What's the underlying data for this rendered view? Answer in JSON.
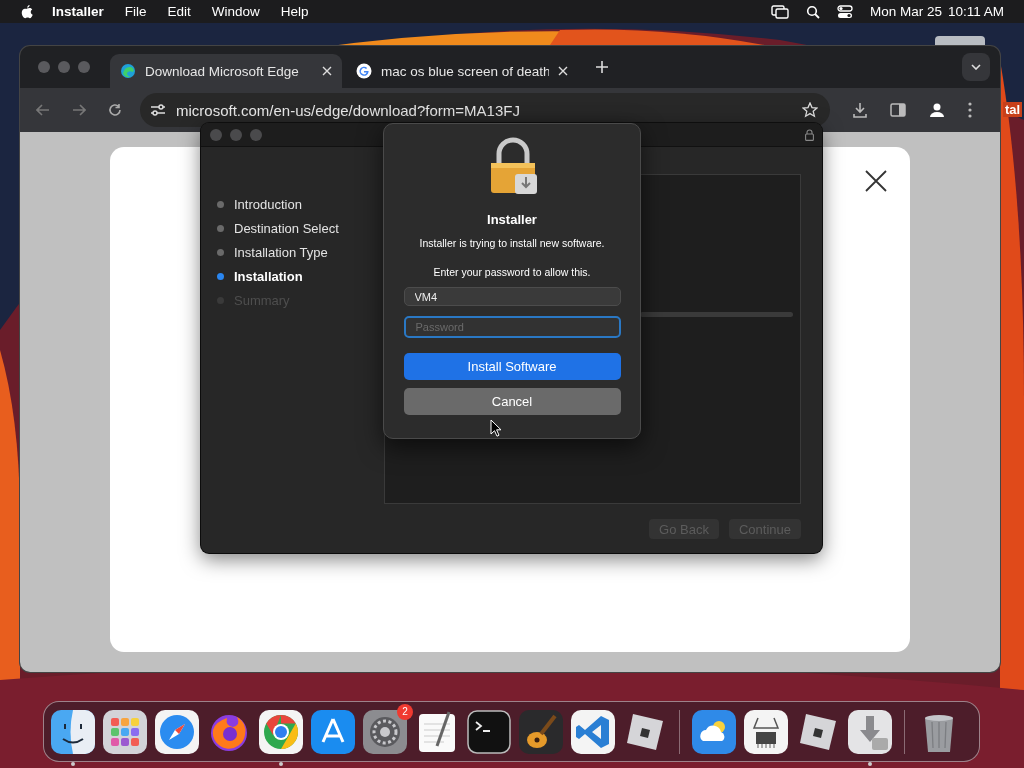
{
  "menu_bar": {
    "app": "Installer",
    "menus": [
      "File",
      "Edit",
      "Window",
      "Help"
    ],
    "date": "Mon Mar 25",
    "time": "10:11 AM"
  },
  "browser": {
    "tabs": [
      {
        "title": "Download Microsoft Edge",
        "selected": true
      },
      {
        "title": "mac os blue screen of death",
        "selected": false
      }
    ],
    "url": "microsoft.com/en-us/edge/download?form=MA13FJ",
    "edge_text": "tal"
  },
  "installer": {
    "steps": [
      {
        "label": "Introduction",
        "selected": false,
        "disabled": false
      },
      {
        "label": "Destination Select",
        "selected": false,
        "disabled": false
      },
      {
        "label": "Installation Type",
        "selected": false,
        "disabled": false
      },
      {
        "label": "Installation",
        "selected": true,
        "disabled": false
      },
      {
        "label": "Summary",
        "selected": false,
        "disabled": true
      }
    ],
    "buttons": [
      {
        "label": "Go Back",
        "disabled": true
      },
      {
        "label": "Continue",
        "disabled": true
      }
    ]
  },
  "dialog": {
    "title": "Installer",
    "message": "Installer is trying to install new software.",
    "prompt": "Enter your password to allow this.",
    "username": "VM4",
    "password": {
      "placeholder": "Password"
    },
    "buttons": [
      {
        "label": "Install Software",
        "kind": "primary"
      },
      {
        "label": "Cancel",
        "kind": "secondary"
      }
    ]
  },
  "dock": {
    "items": [
      {
        "kind": "finder",
        "running": true
      },
      {
        "kind": "launchpad",
        "running": false
      },
      {
        "kind": "safari",
        "running": false
      },
      {
        "kind": "firefox",
        "running": false
      },
      {
        "kind": "chrome",
        "running": true
      },
      {
        "kind": "appstore",
        "running": false
      },
      {
        "kind": "settings",
        "running": false,
        "badge": "2"
      },
      {
        "kind": "textedit",
        "running": false
      },
      {
        "kind": "terminal",
        "running": false
      },
      {
        "kind": "garageband",
        "running": false
      },
      {
        "kind": "vscode",
        "running": false
      },
      {
        "kind": "roblox",
        "running": false
      },
      {
        "kind": "separator"
      },
      {
        "kind": "weather",
        "running": false
      },
      {
        "kind": "sysinfo",
        "running": false
      },
      {
        "kind": "roblox",
        "running": false
      },
      {
        "kind": "installer",
        "running": true
      },
      {
        "kind": "separator"
      },
      {
        "kind": "trash",
        "running": false
      }
    ]
  }
}
